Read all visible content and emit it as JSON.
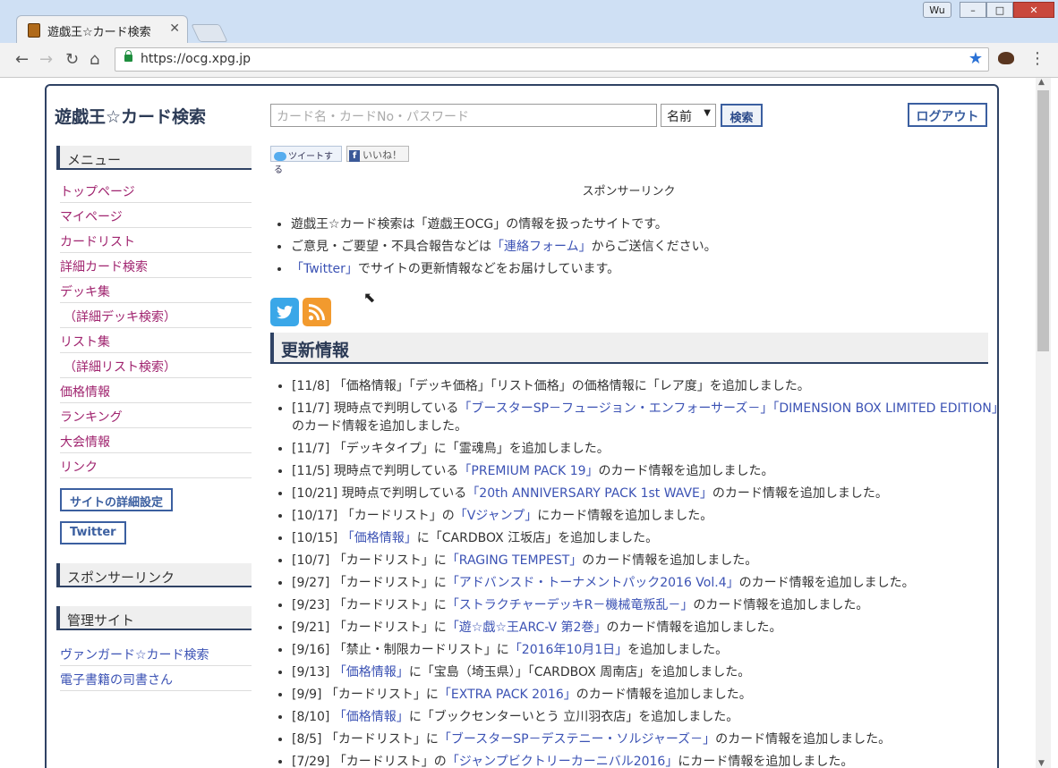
{
  "browser": {
    "tab_title": "遊戯王☆カード検索",
    "tab_close": "✕",
    "user_badge": "Wu",
    "url": "https://ocg.xpg.jp",
    "back": "←",
    "forward": "→",
    "reload": "↻",
    "home": "⌂",
    "bookmark_star": "★",
    "menu": "⋮",
    "minimize": "–",
    "maximize": "□",
    "close": "✕"
  },
  "site_title": "遊戯王☆カード検索",
  "sidebar": {
    "menu_heading": "メニュー",
    "menu_items": [
      {
        "label": "トップページ"
      },
      {
        "label": "マイページ"
      },
      {
        "label": "カードリスト"
      },
      {
        "label": "詳細カード検索"
      },
      {
        "label": "デッキ集"
      },
      {
        "label": "（詳細デッキ検索）"
      },
      {
        "label": "リスト集"
      },
      {
        "label": "（詳細リスト検索）"
      },
      {
        "label": "価格情報"
      },
      {
        "label": "ランキング"
      },
      {
        "label": "大会情報"
      },
      {
        "label": "リンク"
      }
    ],
    "settings_button": "サイトの詳細設定",
    "twitter_button": "Twitter",
    "sponsor_heading": "スポンサーリンク",
    "admin_heading": "管理サイト",
    "admin_items": [
      {
        "label": "ヴァンガード☆カード検索"
      },
      {
        "label": "電子書籍の司書さん"
      }
    ]
  },
  "search": {
    "placeholder": "カード名・カードNo・パスワード",
    "select_value": "名前",
    "button": "検索"
  },
  "logout_button": "ログアウト",
  "share": {
    "tweet": "ツイートする",
    "fb_f": "f",
    "like": "いいね！"
  },
  "sponsor_center": "スポンサーリンク",
  "intro": [
    {
      "pre": "遊戯王☆カード検索は「遊戯王OCG」の情報を扱ったサイトです。",
      "link": "",
      "post": ""
    },
    {
      "pre": "ご意見・ご要望・不具合報告などは",
      "link": "「連絡フォーム」",
      "post": "からご送信ください。"
    },
    {
      "pre": "",
      "link": "「Twitter」",
      "post": "でサイトの更新情報などをお届けしています。"
    }
  ],
  "updates_heading": "更新情報",
  "updates": [
    {
      "pre": "[11/8] 「価格情報」「デッキ価格」「リスト価格」の価格情報に「レア度」を追加しました。",
      "link": "",
      "post": ""
    },
    {
      "pre": "[11/7] 現時点で判明している",
      "link": "「ブースターSP－フュージョン・エンフォーサーズ－」「DIMENSION BOX LIMITED EDITION」",
      "post": "のカード情報を追加しました。"
    },
    {
      "pre": "[11/7] 「デッキタイプ」に「霊魂鳥」を追加しました。",
      "link": "",
      "post": ""
    },
    {
      "pre": "[11/5] 現時点で判明している",
      "link": "「PREMIUM PACK 19」",
      "post": "のカード情報を追加しました。"
    },
    {
      "pre": "[10/21] 現時点で判明している",
      "link": "「20th ANNIVERSARY PACK 1st WAVE」",
      "post": "のカード情報を追加しました。"
    },
    {
      "pre": "[10/17] 「カードリスト」の",
      "link": "「Vジャンプ」",
      "post": "にカード情報を追加しました。"
    },
    {
      "pre": "[10/15] ",
      "link": "「価格情報」",
      "post": "に「CARDBOX 江坂店」を追加しました。"
    },
    {
      "pre": "[10/7] 「カードリスト」に",
      "link": "「RAGING TEMPEST」",
      "post": "のカード情報を追加しました。"
    },
    {
      "pre": "[9/27] 「カードリスト」に",
      "link": "「アドバンスド・トーナメントパック2016 Vol.4」",
      "post": "のカード情報を追加しました。"
    },
    {
      "pre": "[9/23] 「カードリスト」に",
      "link": "「ストラクチャーデッキR－機械竜叛乱－」",
      "post": "のカード情報を追加しました。"
    },
    {
      "pre": "[9/21] 「カードリスト」に",
      "link": "「遊☆戯☆王ARC-V 第2巻」",
      "post": "のカード情報を追加しました。"
    },
    {
      "pre": "[9/16] 「禁止・制限カードリスト」に",
      "link": "「2016年10月1日」",
      "post": "を追加しました。"
    },
    {
      "pre": "[9/13] ",
      "link": "「価格情報」",
      "post": "に「宝島（埼玉県）」「CARDBOX 周南店」を追加しました。"
    },
    {
      "pre": "[9/9] 「カードリスト」に",
      "link": "「EXTRA PACK 2016」",
      "post": "のカード情報を追加しました。"
    },
    {
      "pre": "[8/10] ",
      "link": "「価格情報」",
      "post": "に「ブックセンターいとう 立川羽衣店」を追加しました。"
    },
    {
      "pre": "[8/5] 「カードリスト」に",
      "link": "「ブースターSP－デステニー・ソルジャーズ－」",
      "post": "のカード情報を追加しました。"
    },
    {
      "pre": "[7/29] 「カードリスト」の",
      "link": "「ジャンプビクトリーカーニバル2016」",
      "post": "にカード情報を追加しました。"
    }
  ]
}
